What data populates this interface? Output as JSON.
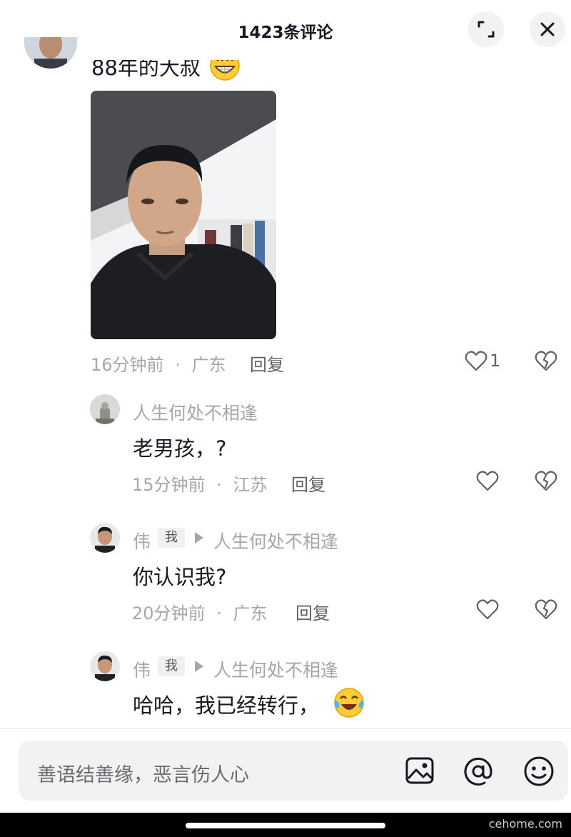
{
  "header": {
    "title": "1423条评论"
  },
  "main_comment": {
    "text": "88年的大叔",
    "time": "16分钟前",
    "location": "广东",
    "reply_label": "回复",
    "like_count": "1"
  },
  "replies": [
    {
      "author": "人生何处不相逢",
      "text": "老男孩，?",
      "time": "15分钟前",
      "location": "江苏",
      "reply_label": "回复"
    },
    {
      "author": "伟",
      "badge": "我",
      "reply_to": "人生何处不相逢",
      "text": "你认识我?",
      "time": "20分钟前",
      "location": "广东",
      "reply_label": "回复"
    },
    {
      "author": "伟",
      "badge": "我",
      "reply_to": "人生何处不相逢",
      "text": "哈哈，我已经转行，"
    }
  ],
  "separator": "·",
  "input": {
    "placeholder": "善语结善缘，恶言伤人心"
  },
  "watermark": "cehome.com"
}
